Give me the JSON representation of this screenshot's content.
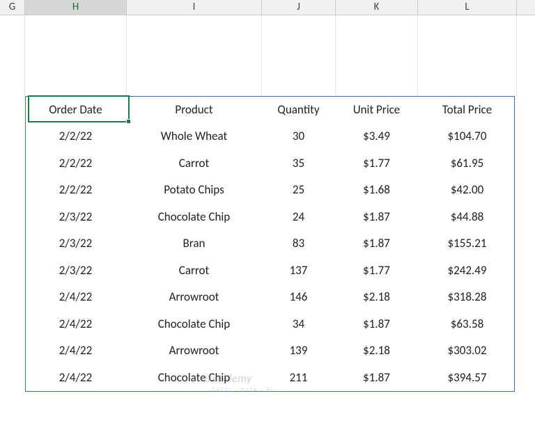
{
  "columns": [
    "G",
    "H",
    "I",
    "J",
    "K",
    "L"
  ],
  "selected_column": "H",
  "table": {
    "headers": [
      "Order Date",
      "Product",
      "Quantity",
      "Unit Price",
      "Total Price"
    ],
    "rows": [
      {
        "date": "2/2/22",
        "product": "Whole Wheat",
        "qty": "30",
        "unit": "$3.49",
        "total": "$104.70"
      },
      {
        "date": "2/2/22",
        "product": "Carrot",
        "qty": "35",
        "unit": "$1.77",
        "total": "$61.95"
      },
      {
        "date": "2/2/22",
        "product": "Potato Chips",
        "qty": "25",
        "unit": "$1.68",
        "total": "$42.00"
      },
      {
        "date": "2/3/22",
        "product": "Chocolate Chip",
        "qty": "24",
        "unit": "$1.87",
        "total": "$44.88"
      },
      {
        "date": "2/3/22",
        "product": "Bran",
        "qty": "83",
        "unit": "$1.87",
        "total": "$155.21"
      },
      {
        "date": "2/3/22",
        "product": "Carrot",
        "qty": "137",
        "unit": "$1.77",
        "total": "$242.49"
      },
      {
        "date": "2/4/22",
        "product": "Arrowroot",
        "qty": "146",
        "unit": "$2.18",
        "total": "$318.28"
      },
      {
        "date": "2/4/22",
        "product": "Chocolate Chip",
        "qty": "34",
        "unit": "$1.87",
        "total": "$63.58"
      },
      {
        "date": "2/4/22",
        "product": "Arrowroot",
        "qty": "139",
        "unit": "$2.18",
        "total": "$303.02"
      },
      {
        "date": "2/4/22",
        "product": "Chocolate Chip",
        "qty": "211",
        "unit": "$1.87",
        "total": "$394.57"
      }
    ]
  },
  "watermark": {
    "main": "exceldemy",
    "sub": "EXCEL · DATA · BI"
  },
  "chart_data": {
    "type": "table",
    "title": "",
    "columns": [
      "Order Date",
      "Product",
      "Quantity",
      "Unit Price",
      "Total Price"
    ],
    "rows": [
      [
        "2/2/22",
        "Whole Wheat",
        30,
        3.49,
        104.7
      ],
      [
        "2/2/22",
        "Carrot",
        35,
        1.77,
        61.95
      ],
      [
        "2/2/22",
        "Potato Chips",
        25,
        1.68,
        42.0
      ],
      [
        "2/3/22",
        "Chocolate Chip",
        24,
        1.87,
        44.88
      ],
      [
        "2/3/22",
        "Bran",
        83,
        1.87,
        155.21
      ],
      [
        "2/3/22",
        "Carrot",
        137,
        1.77,
        242.49
      ],
      [
        "2/4/22",
        "Arrowroot",
        146,
        2.18,
        318.28
      ],
      [
        "2/4/22",
        "Chocolate Chip",
        34,
        1.87,
        63.58
      ],
      [
        "2/4/22",
        "Arrowroot",
        139,
        2.18,
        303.02
      ],
      [
        "2/4/22",
        "Chocolate Chip",
        211,
        1.87,
        394.57
      ]
    ]
  }
}
